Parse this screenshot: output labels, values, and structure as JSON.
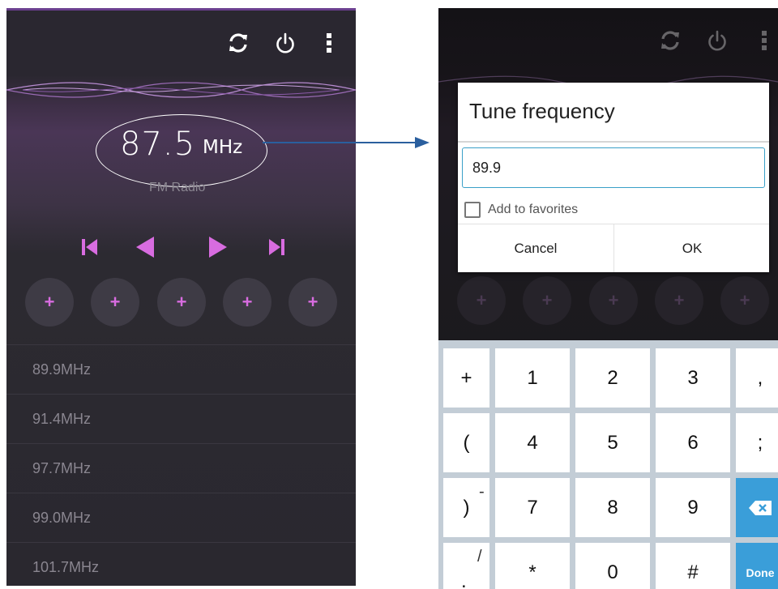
{
  "left": {
    "frequency": "87.5",
    "unit": "MHz",
    "band_label": "FM Radio",
    "preset_label": "+",
    "stations": [
      "89.9",
      "91.4",
      "97.7",
      "99.0",
      "101.7"
    ],
    "station_unit": "MHz"
  },
  "dialog": {
    "title": "Tune frequency",
    "input_value": "89.9",
    "favorites_label": "Add to favorites",
    "favorites_checked": false,
    "cancel": "Cancel",
    "ok": "OK"
  },
  "keyboard": {
    "rows": [
      [
        "+",
        "1",
        "2",
        "3",
        ","
      ],
      [
        "(",
        "4",
        "5",
        "6",
        ";"
      ],
      [
        ")",
        "7",
        "8",
        "9",
        "⌫"
      ],
      [
        ".",
        "*",
        "0",
        "#",
        "Done"
      ]
    ],
    "superscripts": {
      "r2c0": "-",
      "r3c0": "/"
    }
  },
  "colors": {
    "accent": "#d86ce0",
    "keyboard_blue": "#3a9ed9",
    "arrow": "#2a5f9e",
    "input_border": "#3aa0c8"
  }
}
